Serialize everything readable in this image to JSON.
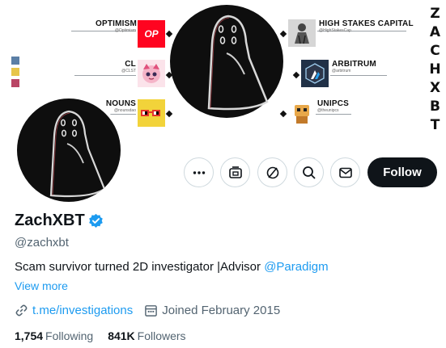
{
  "banner": {
    "vertical_title": "ZACHXBT",
    "swatch_colors": [
      "#5b7fa6",
      "#e7c54b",
      "#b94565"
    ],
    "partners_left": [
      {
        "name": "OPTIMISM",
        "handle": "@Optimism",
        "logo_text": "OP",
        "logo_color": "#ff0420"
      },
      {
        "name": "CL",
        "handle": "@CLST",
        "logo_text": "",
        "logo_color": "#f5b4c8"
      },
      {
        "name": "NOUNS",
        "handle": "@nounsdao",
        "logo_text": "",
        "logo_color": "#f2d33a"
      }
    ],
    "partners_right": [
      {
        "name": "HIGH STAKES CAPITAL",
        "handle": "@HighStakesCap",
        "logo_color": "#cfcfcf"
      },
      {
        "name": "ARBITRUM",
        "handle": "@arbitrum",
        "logo_color": "#213147"
      },
      {
        "name": "UNIPCS",
        "handle": "@theunipcs",
        "logo_color": "#e8a84a"
      }
    ]
  },
  "actions": {
    "more_icon": "ellipsis-icon",
    "grok_icon": "grok-icon",
    "subscribe_icon": "subscribe-icon",
    "search_icon": "search-icon",
    "message_icon": "envelope-icon",
    "follow_label": "Follow"
  },
  "profile": {
    "display_name": "ZachXBT",
    "handle": "@zachxbt",
    "bio_text": "Scam survivor turned 2D investigator |Advisor ",
    "bio_mention": "@Paradigm",
    "view_more": "View more",
    "link": "t.me/investigations",
    "joined": "Joined February 2015",
    "following_count": "1,754",
    "following_label": "Following",
    "followers_count": "841K",
    "followers_label": "Followers"
  },
  "colors": {
    "accent": "#1d9bf0",
    "follow_bg": "#0f1419",
    "muted_text": "#536471"
  }
}
